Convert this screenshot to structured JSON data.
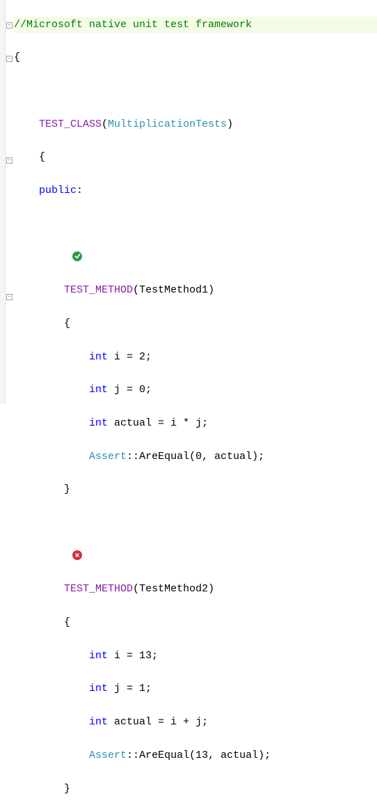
{
  "comment": "//Microsoft native unit test framework",
  "open_brace": "{",
  "test_class": {
    "macro": "TEST_CLASS",
    "name": "MultiplicationTests",
    "open": "{",
    "access": "public",
    "colon": ":"
  },
  "methods": [
    {
      "status": "pass",
      "macro": "TEST_METHOD",
      "name": "TestMethod1",
      "open": "{",
      "body": {
        "decl_i_kw": "int",
        "decl_i": " i = 2;",
        "decl_j_kw": "int",
        "decl_j": " j = 0;",
        "decl_a_kw": "int",
        "decl_a": " actual = i * j;",
        "assert_class": "Assert",
        "assert_sep": "::",
        "assert_fn": "AreEqual",
        "assert_args": "(0, actual);"
      },
      "close": "}"
    },
    {
      "status": "fail",
      "macro": "TEST_METHOD",
      "name": "TestMethod2",
      "open": "{",
      "body": {
        "decl_i_kw": "int",
        "decl_i": " i = 13;",
        "decl_j_kw": "int",
        "decl_j": " j = 1;",
        "decl_a_kw": "int",
        "decl_a": " actual = i + j;",
        "assert_class": "Assert",
        "assert_sep": "::",
        "assert_fn": "AreEqual",
        "assert_args": "(13, actual);"
      },
      "close": "}"
    }
  ]
}
